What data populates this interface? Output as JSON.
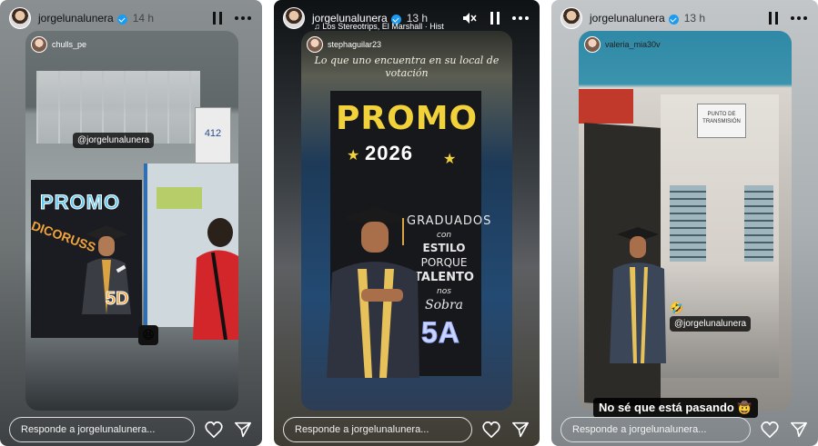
{
  "stories": [
    {
      "username": "jorgelunalunera",
      "time": "14 h",
      "shared_from": "chulls_pe",
      "mention_tag": "@jorgelunalunera",
      "poster": {
        "title": "PROMO",
        "subtitle": "DICORUSS",
        "section": "5D",
        "room_sign": "412"
      },
      "sticker_emoji": "😆",
      "reply_placeholder": "Responde a jorgelunalunera..."
    },
    {
      "username": "jorgelunalunera",
      "time": "13 h",
      "music": "Los Stereotrips, El Marshall · Hist",
      "shared_from": "stephaguilar23",
      "caption": "Lo que uno encuentra en su local de votación",
      "poster": {
        "title": "PROMO",
        "year": "2026",
        "lines": [
          "GRADUADOS",
          "con",
          "ESTILO",
          "PORQUE",
          "TALENTO",
          "nos",
          "Sobra"
        ],
        "section": "5A"
      },
      "reply_placeholder": "Responde a jorgelunalunera..."
    },
    {
      "username": "jorgelunalunera",
      "time": "13 h",
      "shared_from": "valeria_mia30v",
      "room_sign": "PUNTO DE TRANSMISIÓN",
      "mention_tag": "@jorgelunalunera",
      "mention_emoji": "🤣",
      "caption": "No sé que está pasando 🤠",
      "reply_placeholder": "Responde a jorgelunalunera..."
    }
  ]
}
